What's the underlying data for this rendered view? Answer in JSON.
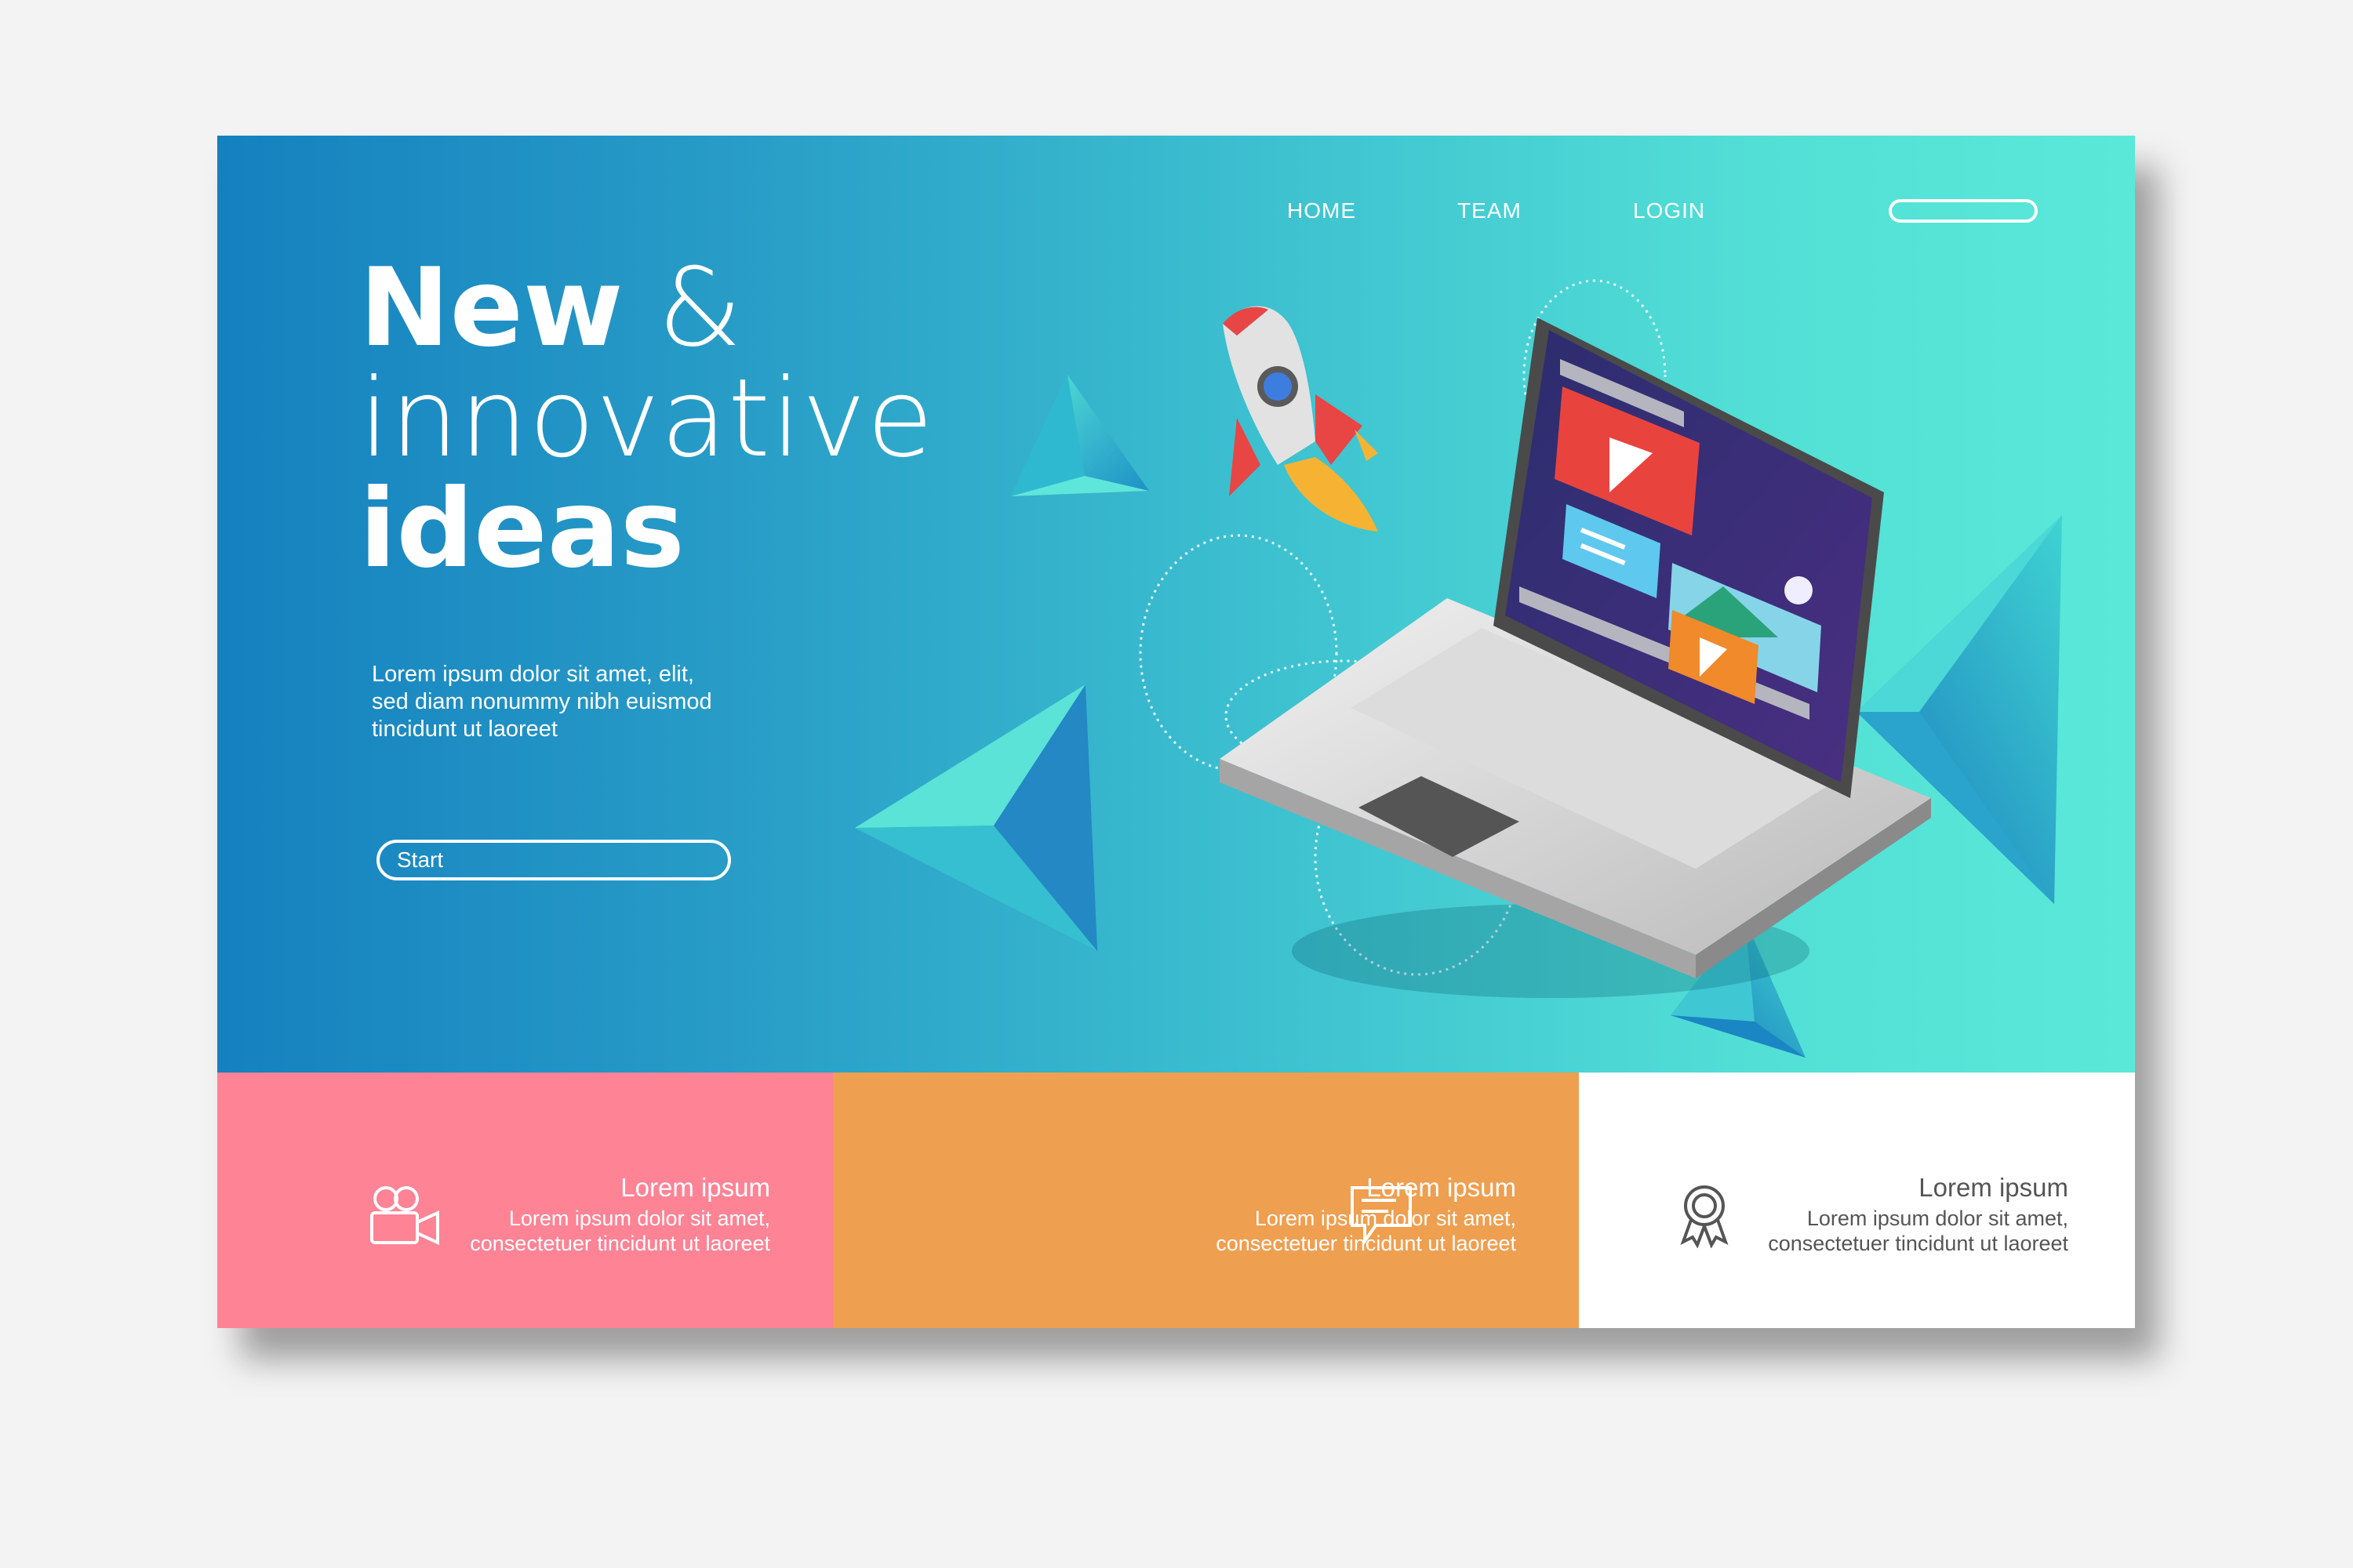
{
  "nav": {
    "items": [
      {
        "label": "HOME"
      },
      {
        "label": "TEAM"
      },
      {
        "label": "LOGIN"
      }
    ]
  },
  "hero": {
    "headline_bold": "New",
    "headline_amp": "&",
    "headline_line2": "innovative",
    "headline_line3": "ideas",
    "description_lines": [
      "Lorem ipsum dolor sit amet,  elit,",
      "sed diam nonummy nibh euismod",
      "tincidunt ut laoreet"
    ],
    "start_button": "Start"
  },
  "features": [
    {
      "icon": "video-camera-icon",
      "title": "Lorem ipsum",
      "line1": "Lorem ipsum dolor sit amet,",
      "line2": "consectetuer tincidunt ut laoreet",
      "color": "#fd8395"
    },
    {
      "icon": "chat-bubble-icon",
      "title": "Lorem ipsum",
      "line1": "Lorem ipsum dolor sit amet,",
      "line2": "consectetuer tincidunt ut laoreet",
      "color": "#ef9f50"
    },
    {
      "icon": "award-ribbon-icon",
      "title": "Lorem ipsum",
      "line1": "Lorem ipsum dolor sit amet,",
      "line2": "consectetuer tincidunt ut laoreet",
      "color": "#ffffff"
    }
  ]
}
